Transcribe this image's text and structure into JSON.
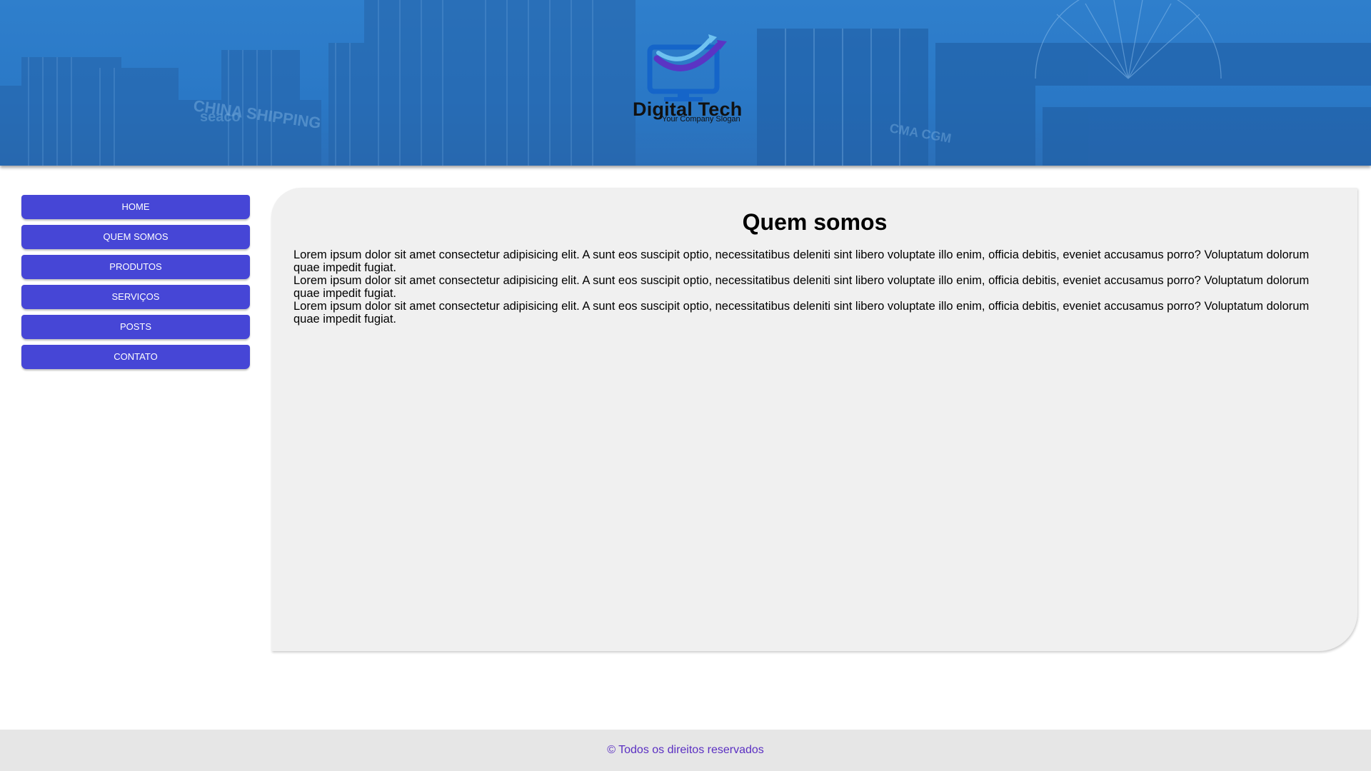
{
  "header": {
    "brand_name": "Digital Tech",
    "slogan": "Your Company Slogan",
    "background_text": [
      "CHINA SHIPPING",
      "seaco",
      "CMA CGM"
    ]
  },
  "nav": {
    "items": [
      {
        "label": "HOME"
      },
      {
        "label": "QUEM SOMOS"
      },
      {
        "label": "PRODUTOS"
      },
      {
        "label": "SERVIÇOS"
      },
      {
        "label": "POSTS"
      },
      {
        "label": "CONTATO"
      }
    ]
  },
  "main": {
    "title": "Quem somos",
    "paragraphs": [
      "Lorem ipsum dolor sit amet consectetur adipisicing elit. A sunt eos suscipit optio, necessitatibus deleniti sint libero voluptate illo enim, officia debitis, eveniet accusamus porro? Voluptatum dolorum quae impedit fugiat.",
      "Lorem ipsum dolor sit amet consectetur adipisicing elit. A sunt eos suscipit optio, necessitatibus deleniti sint libero voluptate illo enim, officia debitis, eveniet accusamus porro? Voluptatum dolorum quae impedit fugiat.",
      "Lorem ipsum dolor sit amet consectetur adipisicing elit. A sunt eos suscipit optio, necessitatibus deleniti sint libero voluptate illo enim, officia debitis, eveniet accusamus porro? Voluptatum dolorum quae impedit fugiat."
    ]
  },
  "footer": {
    "text": "© Todos os direitos reservados"
  },
  "colors": {
    "header_blue": "#2a78c6",
    "nav_button": "#4646d6",
    "content_bg": "#f0f0f0",
    "footer_bg": "#e6e6e6",
    "footer_text": "#5a2fc2"
  },
  "icons": [
    "logo-monitor-icon",
    "logo-arrow-icon"
  ]
}
